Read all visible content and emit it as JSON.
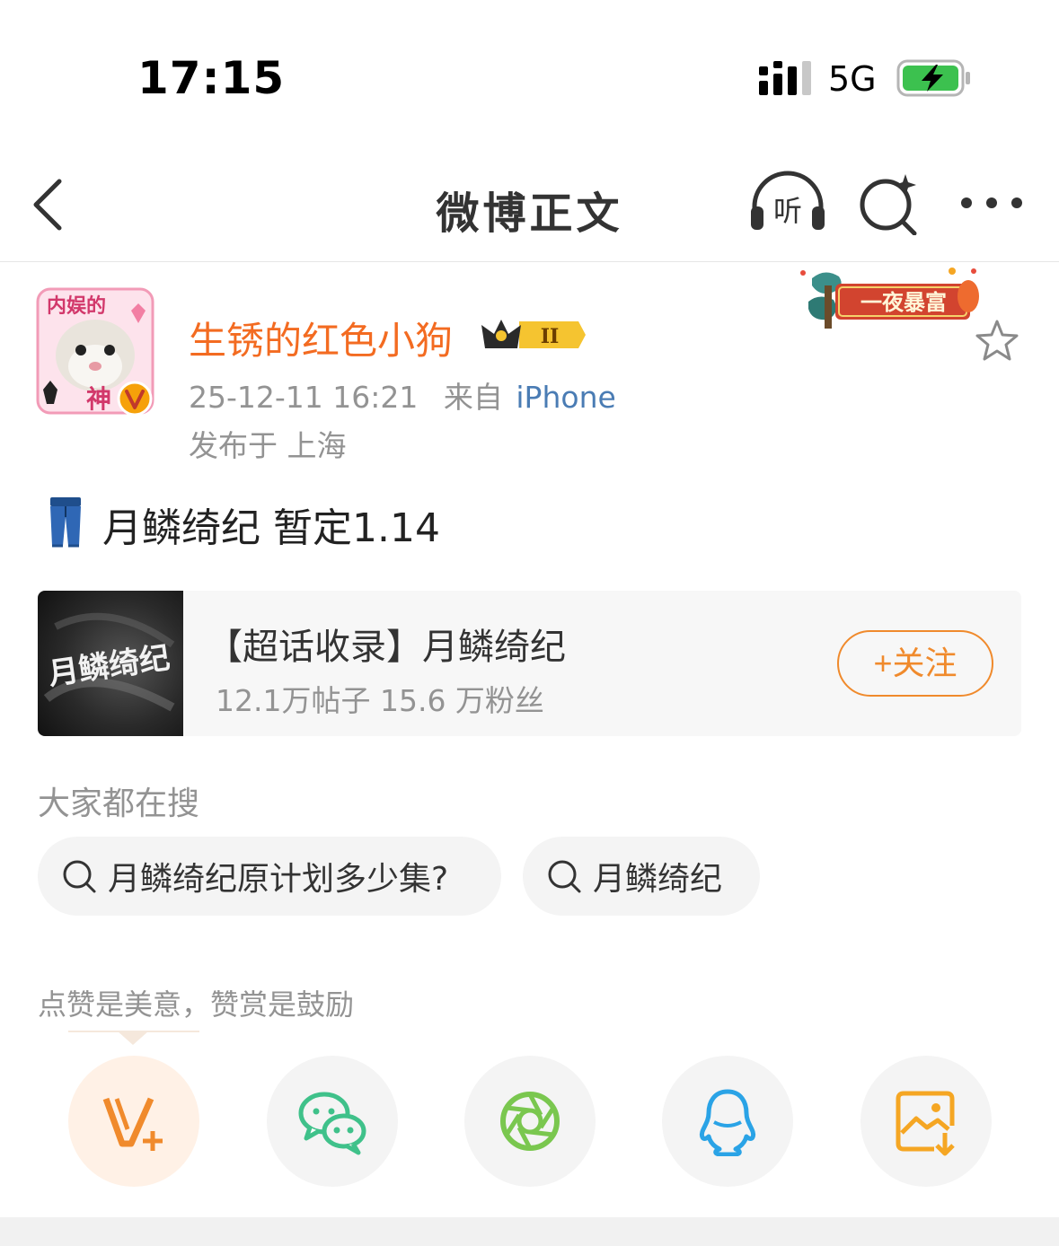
{
  "status_bar": {
    "time": "17:15",
    "network": "5G"
  },
  "nav": {
    "title": "微博正文",
    "listen_label": "听"
  },
  "author": {
    "name": "生锈的红色小狗",
    "level_badge": "II",
    "timestamp": "25-12-11 16:21",
    "source_prefix": "来自",
    "source": "iPhone",
    "location": "发布于 上海",
    "avatar_caption_top": "内娱的",
    "avatar_caption_bottom": "神",
    "decor_banner_text": "一夜暴富"
  },
  "post": {
    "text": "月鳞绮纪 暂定1.14"
  },
  "topic_card": {
    "title": "【超话收录】月鳞绮纪",
    "stats": "12.1万帖子 15.6 万粉丝",
    "follow_label": "+关注",
    "thumb_text": "月鳞绮纪"
  },
  "search": {
    "heading": "大家都在搜",
    "chips": [
      "月鳞绮纪原计划多少集?",
      "月鳞绮纪"
    ]
  },
  "share": {
    "hint": "点赞是美意，赞赏是鼓励"
  },
  "colors": {
    "author_name": "#f36b21",
    "source_link": "#4a7cb4",
    "follow_accent": "#f08a2c",
    "wechat_green": "#3fc18a",
    "moments_green": "#7ac74f",
    "qq_blue": "#2aa3e6",
    "save_orange": "#f5a623"
  }
}
